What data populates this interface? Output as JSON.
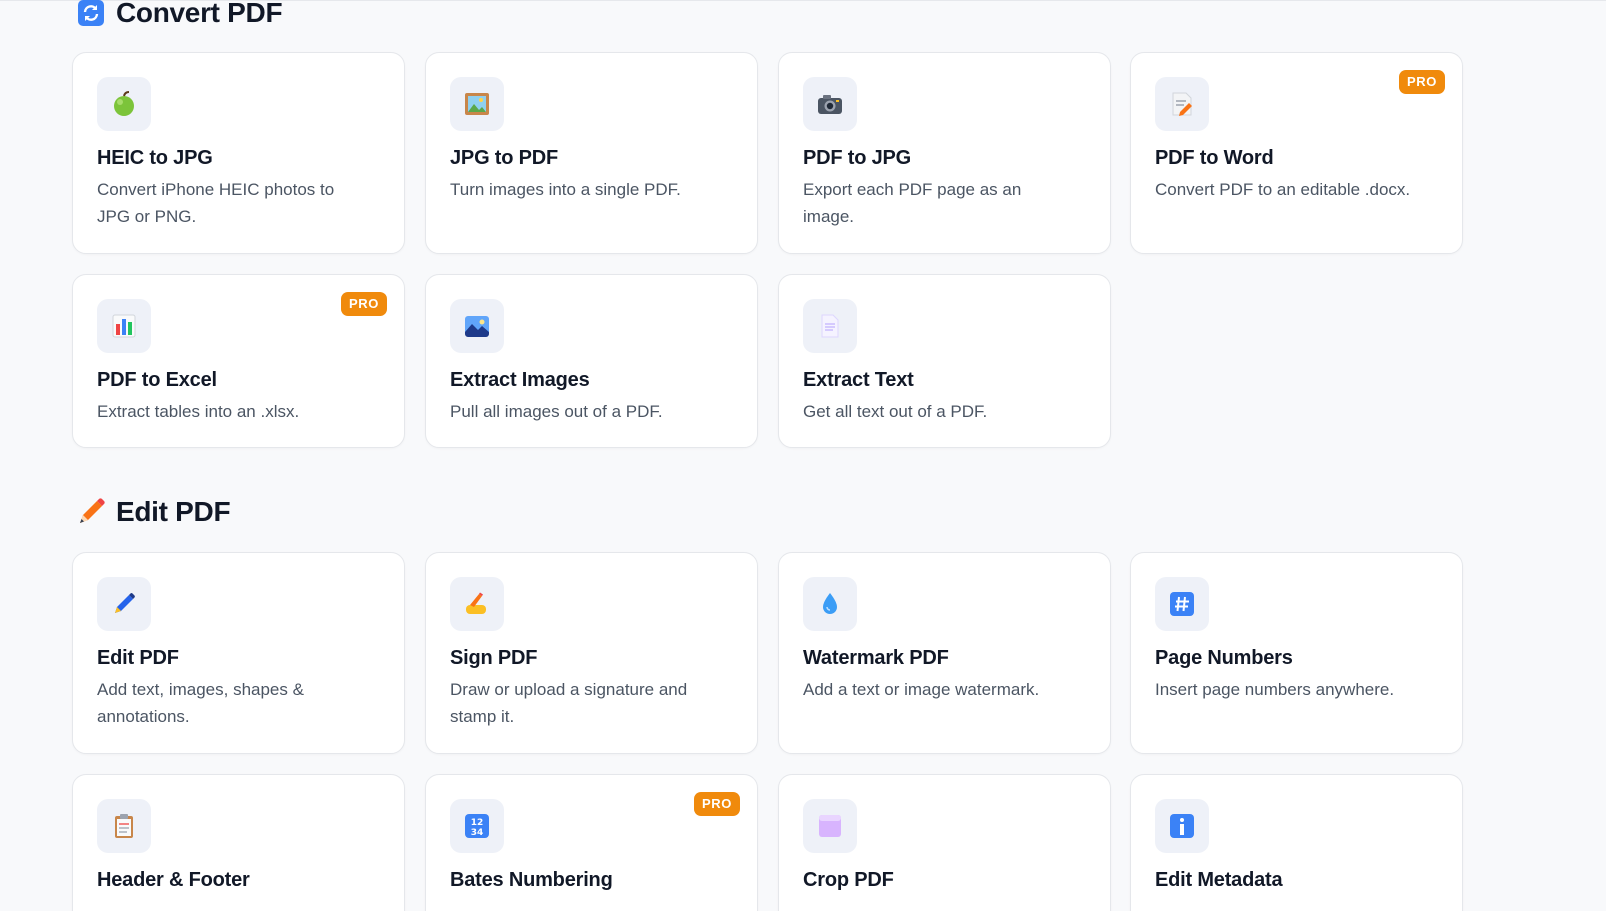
{
  "sections": {
    "convert": {
      "title": "Convert PDF",
      "icon": "arrows-cycle-icon"
    },
    "edit": {
      "title": "Edit PDF",
      "icon": "pencil-icon"
    }
  },
  "badge_label": "PRO",
  "colors": {
    "pro_badge": "#f08a0c",
    "card_bg": "#ffffff",
    "page_bg": "#f8f9fb",
    "tile_bg": "#eef1f8"
  },
  "cards": [
    {
      "title": "HEIC to JPG",
      "desc": "Convert iPhone HEIC photos to JPG or PNG.",
      "icon": "green-apple-icon",
      "pro": false
    },
    {
      "title": "JPG to PDF",
      "desc": "Turn images into a single PDF.",
      "icon": "framed-picture-icon",
      "pro": false
    },
    {
      "title": "PDF to JPG",
      "desc": "Export each PDF page as an image.",
      "icon": "camera-icon",
      "pro": false
    },
    {
      "title": "PDF to Word",
      "desc": "Convert PDF to an editable .docx.",
      "icon": "memo-icon",
      "pro": true
    },
    {
      "title": "PDF to Excel",
      "desc": "Extract tables into an .xlsx.",
      "icon": "bar-chart-icon",
      "pro": true
    },
    {
      "title": "Extract Images",
      "desc": "Pull all images out of a PDF.",
      "icon": "landscape-icon",
      "pro": false
    },
    {
      "title": "Extract Text",
      "desc": "Get all text out of a PDF.",
      "icon": "page-icon",
      "pro": false
    },
    {
      "title": "Edit PDF",
      "desc": "Add text, images, shapes & annotations.",
      "icon": "pen-icon",
      "pro": false
    },
    {
      "title": "Sign PDF",
      "desc": "Draw or upload a signature and stamp it.",
      "icon": "writing-hand-icon",
      "pro": false
    },
    {
      "title": "Watermark PDF",
      "desc": "Add a text or image watermark.",
      "icon": "droplet-icon",
      "pro": false
    },
    {
      "title": "Page Numbers",
      "desc": "Insert page numbers anywhere.",
      "icon": "hash-keycap-icon",
      "pro": false
    },
    {
      "title": "Header & Footer",
      "desc": "",
      "icon": "clipboard-icon",
      "pro": false
    },
    {
      "title": "Bates Numbering",
      "desc": "",
      "icon": "numbers-1234-icon",
      "pro": true
    },
    {
      "title": "Crop PDF",
      "desc": "",
      "icon": "square-crop-icon",
      "pro": false
    },
    {
      "title": "Edit Metadata",
      "desc": "",
      "icon": "info-icon",
      "pro": false
    }
  ]
}
